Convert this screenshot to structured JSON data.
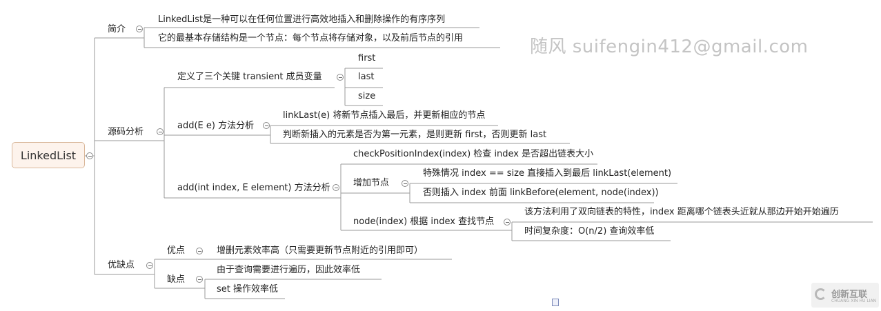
{
  "colors": {
    "line": "#9a9a9a",
    "root_fill": "#fdf3ec",
    "root_border": "#d9b79a",
    "watermark": "#c4c4c4"
  },
  "root": {
    "label": "LinkedList"
  },
  "intro": {
    "label": "简介",
    "items": [
      "LinkedList是一种可以在任何位置进行高效地插入和删除操作的有序序列",
      "它的最基本存储结构是一个节点：每个节点将存储对象，以及前后节点的引用"
    ]
  },
  "source": {
    "label": "源码分析",
    "fields": {
      "label": "定义了三个关键 transient 成员变量",
      "items": [
        "first",
        "last",
        "size"
      ]
    },
    "add": {
      "label": "add(E e) 方法分析",
      "items": [
        "linkLast(e)  将新节点插入最后，并更新相应的节点",
        "判断新插入的元素是否为第一元素，是则更新 first，否则更新 last"
      ]
    },
    "add_index": {
      "label": "add(int index, E element) 方法分析",
      "check": "checkPositionIndex(index)  检查 index 是否超出链表大小",
      "add_node": {
        "label": "增加节点",
        "items": [
          "特殊情况  index == size  直接插入到最后  linkLast(element)",
          "否则插入  index 前面  linkBefore(element, node(index))"
        ]
      },
      "node": {
        "label": "node(index)  根据 index 查找节点",
        "items": [
          "该方法利用了双向链表的特性，index 距离哪个链表头近就从那边开始开始遍历",
          "时间复杂度：O(n/2)  查询效率低"
        ]
      }
    }
  },
  "pros_cons": {
    "label": "优缺点",
    "pros": {
      "label": "优点",
      "items": [
        "增删元素效率高（只需要更新节点附近的引用即可）"
      ]
    },
    "cons": {
      "label": "缺点",
      "items": [
        "由于查询需要进行遍历，因此效率低",
        "set 操作效率低"
      ]
    }
  },
  "watermark": "随风  suifengin412@gmail.com",
  "logo": {
    "name": "创新互联",
    "sub": "CHUANG XIN HU LIAN"
  }
}
